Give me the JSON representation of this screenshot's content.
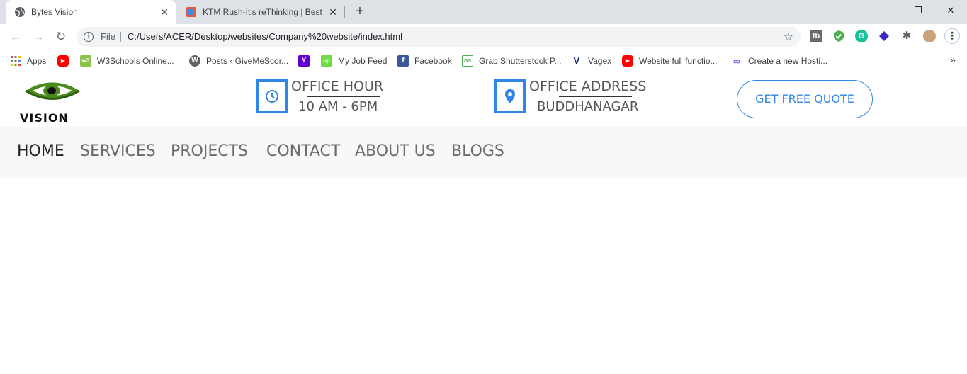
{
  "browser": {
    "tabs": [
      {
        "title": "Bytes Vision",
        "active": true
      },
      {
        "title": "KTM Rush-It's reThinking | Best W",
        "active": false
      }
    ],
    "new_tab_symbol": "+",
    "close_symbol": "✕",
    "window_controls": {
      "minimize": "—",
      "restore": "❐",
      "close": "✕"
    },
    "address": {
      "scheme": "File",
      "url": "C:/Users/ACER/Desktop/websites/Company%20website/index.html"
    },
    "bookmarks": [
      {
        "label": "Apps",
        "icon": "apps-grid-icon"
      },
      {
        "label": "",
        "icon": "youtube-icon"
      },
      {
        "label": "W3Schools Online...",
        "icon": "w3schools-icon"
      },
      {
        "label": "Posts ‹ GiveMeScor...",
        "icon": "wordpress-icon"
      },
      {
        "label": "",
        "icon": "yahoo-icon"
      },
      {
        "label": "My Job Feed",
        "icon": "upwork-icon"
      },
      {
        "label": "Facebook",
        "icon": "facebook-icon"
      },
      {
        "label": "Grab Shutterstock P...",
        "icon": "shutterstock-icon"
      },
      {
        "label": "Vagex",
        "icon": "vagex-icon"
      },
      {
        "label": "Website full functio...",
        "icon": "youtube-icon"
      },
      {
        "label": "Create a new Hosti...",
        "icon": "infinity-icon"
      }
    ],
    "bookmarks_more": "»"
  },
  "site": {
    "logo_text": "VISION",
    "office_hour": {
      "heading": "OFFICE HOUR",
      "value": "10 AM - 6PM"
    },
    "office_address": {
      "heading": "OFFICE ADDRESS",
      "value": "BUDDHANAGAR"
    },
    "quote_button": "GET FREE QUOTE",
    "nav": [
      "HOME",
      "SERVICES",
      "PROJECTS",
      "CONTACT",
      "ABOUT US",
      "BLOGS"
    ],
    "active_nav": "HOME",
    "colors": {
      "accent": "#2f86e6",
      "navbar_bg": "#f7f8fa",
      "logo_green": "#4a8a1c"
    }
  }
}
